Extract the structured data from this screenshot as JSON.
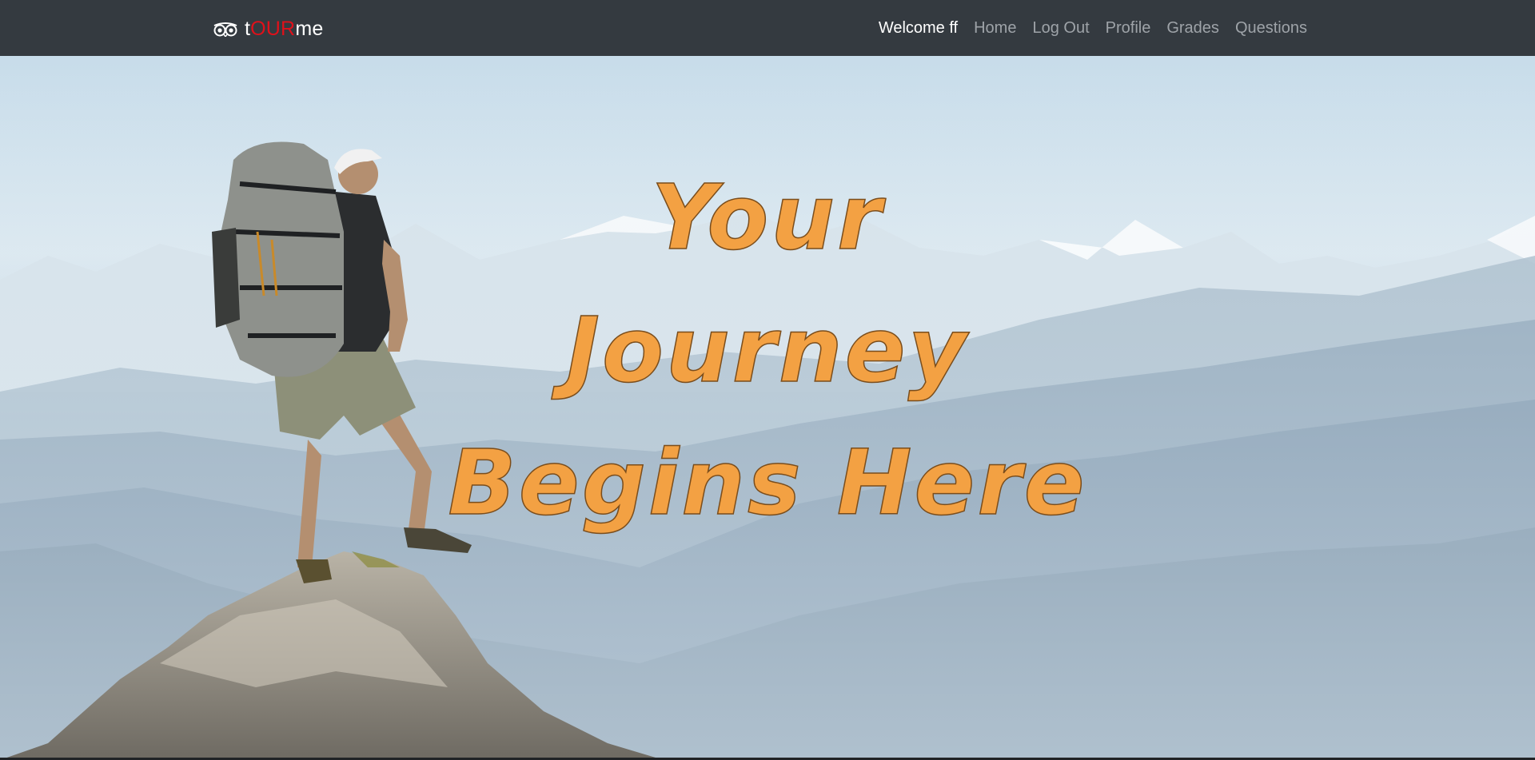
{
  "brand": {
    "prefix": "t",
    "accent": "OUR",
    "suffix": "me",
    "accent_color": "#e0101a",
    "icon": "owl-eyes-icon"
  },
  "nav": {
    "welcome": "Welcome ff",
    "items": [
      "Home",
      "Log Out",
      "Profile",
      "Grades",
      "Questions"
    ]
  },
  "hero": {
    "line1": "Your Journey",
    "line2": "Begins Here",
    "text_color": "#f3a143",
    "background": "hiker-on-mountain-photo"
  },
  "colors": {
    "navbar_bg": "#343a40",
    "nav_link": "#9ea3a8",
    "nav_active": "#ffffff"
  }
}
